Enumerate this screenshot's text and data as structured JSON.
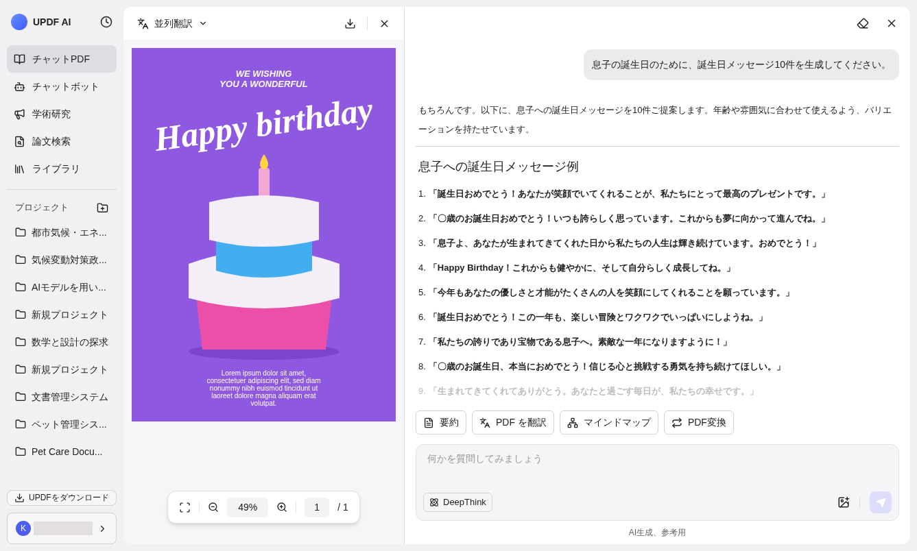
{
  "sidebar": {
    "logo_text": "UPDF AI",
    "nav": [
      {
        "label": "チャットPDF",
        "selected": true
      },
      {
        "label": "チャットボット",
        "selected": false
      },
      {
        "label": "学術研究",
        "selected": false
      },
      {
        "label": "論文検索",
        "selected": false
      },
      {
        "label": "ライブラリ",
        "selected": false
      }
    ],
    "projects_header": "プロジェクト",
    "projects": [
      "都市気候・エネ...",
      "気候変動対策政...",
      "AIモデルを用い...",
      "新規プロジェクト",
      "数学と設計の探求",
      "新規プロジェクト",
      "文書管理システム",
      "ペット管理シス...",
      "Pet Care Docu..."
    ],
    "download_button": "UPDFをダウンロード",
    "user": {
      "initial": "K"
    }
  },
  "viewer": {
    "mode_label": "並列翻訳",
    "page": {
      "top_text": "WE WISHING\nYOU A WONDERFUL",
      "title": "Happy birthday",
      "body": "Lorem ipsum dolor sit amet, consectetuer adipiscing elit, sed diam nonummy nibh euismod tincidunt ut laoreet dolore magna aliquam erat volutpat."
    },
    "toolbar": {
      "zoom": "49%",
      "page": "1",
      "total": "/ 1"
    }
  },
  "chat": {
    "user_message": "息子の誕生日のために、誕生日メッセージ10件を生成してください。",
    "reply_intro": "もちろんです。以下に、息子への誕生日メッセージを10件ご提案します。年齢や雰囲気に合わせて使えるよう、バリエーションを持たせています。",
    "heading": "息子への誕生日メッセージ例",
    "messages": [
      {
        "number": "1.",
        "text": "「誕生日おめでとう！あなたが笑顔でいてくれることが、私たちにとって最高のプレゼントです。」",
        "faded": false
      },
      {
        "number": "2.",
        "text": "「〇歳のお誕生日おめでとう！いつも誇らしく思っています。これからも夢に向かって進んでね。」",
        "faded": false
      },
      {
        "number": "3.",
        "text": "「息子よ、あなたが生まれてきてくれた日から私たちの人生は輝き続けています。おめでとう！」",
        "faded": false
      },
      {
        "number": "4.",
        "text": "「Happy Birthday！これからも健やかに、そして自分らしく成長してね。」",
        "faded": false
      },
      {
        "number": "5.",
        "text": "「今年もあなたの優しさと才能がたくさんの人を笑顔にしてくれることを願っています。」",
        "faded": false
      },
      {
        "number": "6.",
        "text": "「誕生日おめでとう！この一年も、楽しい冒険とワクワクでいっぱいにしようね。」",
        "faded": false
      },
      {
        "number": "7.",
        "text": "「私たちの誇りであり宝物である息子へ。素敵な一年になりますように！」",
        "faded": false
      },
      {
        "number": "8.",
        "text": "「〇歳のお誕生日、本当におめでとう！信じる心と挑戦する勇気を持ち続けてほしい。」",
        "faded": false
      },
      {
        "number": "9.",
        "text": "「生まれてきてくれてありがとう。あなたと過ごす毎日が、私たちの幸せです。」",
        "faded": true
      }
    ],
    "actions": [
      "要約",
      "PDF を翻訳",
      "マインドマップ",
      "PDF変換"
    ],
    "input": {
      "placeholder": "何かを質問してみましょう"
    },
    "deepthink_button": "DeepThink",
    "footer": "AI生成、参考用"
  }
}
